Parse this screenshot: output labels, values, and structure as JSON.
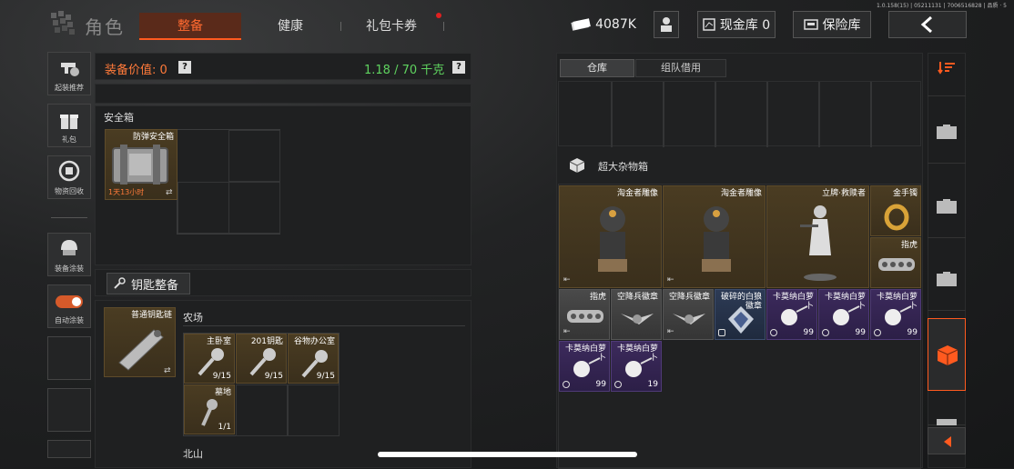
{
  "version": "1.0.158(15) | 05211131 | 7006516828 | 品质 · 5",
  "header": {
    "title": "角色",
    "tabs": [
      {
        "label": "整备"
      },
      {
        "label": "健康"
      },
      {
        "label": "礼包卡券"
      }
    ],
    "money": "4087K",
    "cash_vault": "现金库 0",
    "safe_vault": "保险库"
  },
  "sidebar": {
    "items": [
      {
        "label": "起装推荐"
      },
      {
        "label": "礼包"
      },
      {
        "label": "物资回收"
      },
      {
        "label": "装备涂装"
      },
      {
        "label": "自动涂装"
      }
    ]
  },
  "loadout": {
    "value_label": "装备价值: 0",
    "help": "?",
    "weight": "1.18 / 70 千克",
    "safebox_title": "安全箱",
    "safebox_item": {
      "name": "防弹安全箱",
      "timer": "1天13小时"
    },
    "keys_title": "钥匙整备",
    "keychain_name": "普通钥匙链",
    "farm_label": "农场",
    "keys": [
      {
        "name": "主卧室",
        "count": "9/15"
      },
      {
        "name": "201钥匙",
        "count": "9/15"
      },
      {
        "name": "谷物办公室",
        "count": "9/15"
      },
      {
        "name": "墓地",
        "count": "1/1"
      }
    ],
    "north_label": "北山"
  },
  "warehouse": {
    "tabs": [
      {
        "label": "仓库"
      },
      {
        "label": "组队借用"
      }
    ],
    "box_title": "超大杂物箱",
    "items": [
      {
        "name": "淘金者雕像",
        "count": ""
      },
      {
        "name": "淘金者雕像",
        "count": ""
      },
      {
        "name": "立牌·救赎者",
        "count": ""
      },
      {
        "name": "金手镯",
        "count": ""
      },
      {
        "name": "指虎",
        "count": ""
      },
      {
        "name": "指虎",
        "count": ""
      },
      {
        "name": "空降兵徽章",
        "count": ""
      },
      {
        "name": "空降兵徽章",
        "count": ""
      },
      {
        "name": "破碎的白狼徽章",
        "count": ""
      },
      {
        "name": "卡莫纳白萝卜",
        "count": "99"
      },
      {
        "name": "卡莫纳白萝卜",
        "count": "99"
      },
      {
        "name": "卡莫纳白萝卜",
        "count": "99"
      },
      {
        "name": "卡莫纳白萝卜",
        "count": "99"
      },
      {
        "name": "卡莫纳白萝卜",
        "count": "19"
      }
    ]
  },
  "colors": {
    "accent": "#ff5a1f",
    "weight": "#5fd35f",
    "value": "#ff7a3a"
  }
}
